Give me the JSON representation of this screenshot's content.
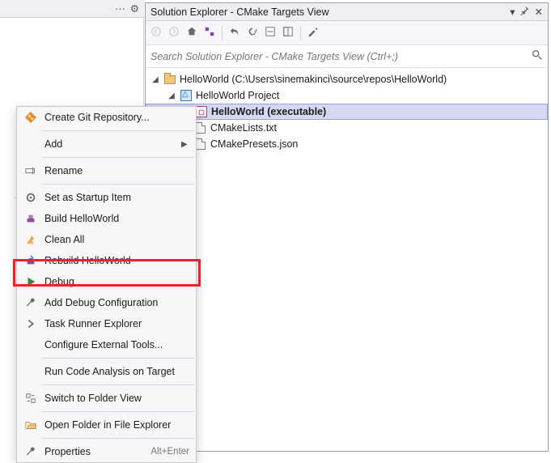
{
  "toolbar_top_left": {
    "ellipsis": "⋯",
    "gear": "⚙"
  },
  "panel": {
    "title": "Solution Explorer - CMake Targets View",
    "title_icons": {
      "dropdown": "▾",
      "pin": "📌",
      "close": "✕"
    },
    "search_placeholder": "Search Solution Explorer - CMake Targets View (Ctrl+;)",
    "toolbar_icons": [
      "back",
      "forward",
      "home",
      "switch-views",
      "undo",
      "refresh",
      "collapse",
      "expand",
      "properties"
    ]
  },
  "tree": {
    "root": {
      "label": "HelloWorld (C:\\Users\\sinemakinci\\source\\repos\\HelloWorld)"
    },
    "project": {
      "label": "HelloWorld Project"
    },
    "target": {
      "label": "HelloWorld (executable)"
    },
    "files": [
      {
        "label": "CMakeLists.txt"
      },
      {
        "label": "CMakePresets.json"
      }
    ]
  },
  "context_menu": {
    "items": [
      {
        "icon": "git-icon",
        "label": "Create Git Repository...",
        "submenu": false
      },
      "sep",
      {
        "icon": "",
        "label": "Add",
        "submenu": true
      },
      "sep",
      {
        "icon": "rename-icon",
        "label": "Rename",
        "submenu": false
      },
      "sep",
      {
        "icon": "gear-icon",
        "label": "Set as Startup Item",
        "submenu": false
      },
      {
        "icon": "build-icon",
        "label": "Build HelloWorld",
        "submenu": false
      },
      {
        "icon": "broom-icon",
        "label": "Clean All",
        "submenu": false
      },
      {
        "icon": "rebuild-icon",
        "label": "Rebuild HelloWorld",
        "submenu": false
      },
      {
        "icon": "play-icon",
        "label": "Debug",
        "submenu": false,
        "highlighted": true
      },
      {
        "icon": "wrench-icon",
        "label": "Add Debug Configuration",
        "submenu": false
      },
      {
        "icon": "chevron-icon",
        "label": "Task Runner Explorer",
        "submenu": false
      },
      {
        "icon": "",
        "label": "Configure External Tools...",
        "submenu": false
      },
      "sep",
      {
        "icon": "",
        "label": "Run Code Analysis on Target",
        "submenu": false
      },
      "sep",
      {
        "icon": "switch-icon",
        "label": "Switch to Folder View",
        "submenu": false
      },
      "sep",
      {
        "icon": "folder-open-icon",
        "label": "Open Folder in File Explorer",
        "submenu": false
      },
      "sep",
      {
        "icon": "wrench-icon",
        "label": "Properties",
        "submenu": false,
        "shortcut": "Alt+Enter"
      }
    ]
  },
  "colors": {
    "selection_bg": "#d6d7f1",
    "selection_border": "#9aa0d6",
    "highlight": "#e22222",
    "panel_border": "#9a9eb5"
  }
}
